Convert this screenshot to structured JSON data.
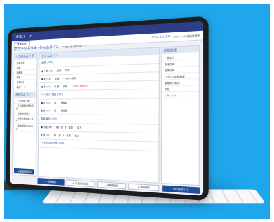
{
  "app": {
    "title": "守護パーク"
  },
  "header": {
    "tab_label": "業務画面",
    "logo_text": "ワイエスケアAI",
    "user_text": "ログイン中 施設管理者"
  },
  "left_panel": {
    "title": "クラスのようす",
    "items": [
      "基本情報",
      "記録",
      "連絡帳",
      "健康",
      "食事状況",
      "検査データ"
    ],
    "section_title": "現在のようす",
    "section_items": [
      "・生活記録 2件",
      "・生活場面の現在記録",
      "・連絡帳の記入",
      "・記録の追加をします",
      "・配信機能のお知らせ"
    ],
    "button_label": "+ 新規記録追加"
  },
  "main_panel": {
    "header_label": "タイムライン",
    "filter_label": "▼ 絞込 (全一覧表示)",
    "rows": [
      {
        "label": "記録 (1件)",
        "col1": "",
        "col2": "",
        "col3": ""
      },
      {
        "label": "● 午前 (18)",
        "col1": "記録",
        "col2": "対応",
        "col3": ""
      },
      {
        "label": "● 朝 (21)",
        "col1": "食事",
        "col2": "バイタル記録",
        "col3": ""
      },
      {
        "label": "● 昼 (21)",
        "col1": "体温",
        "col2": "血圧",
        "col3": "110/60 異常あり"
      },
      {
        "label": "バイタル 測定 (3件)",
        "col1": "",
        "col2": "",
        "col3": ""
      },
      {
        "label": "● 昼 (21)",
        "col1": "熱",
        "col2": "未確認",
        "col3": ""
      },
      {
        "label": "● 夜 (21)",
        "col1": "熱",
        "col2": "未確認",
        "col3": ""
      },
      {
        "label": "服薬管理 (3件)",
        "col1": "",
        "col2": "",
        "col3": ""
      },
      {
        "label": "● 午後 (18)",
        "col1": "朝 · 昼 · 夕 · 就寝",
        "col2": "処方",
        "col3": ""
      },
      {
        "label": "● 夜 (21)",
        "col1": "朝 · 昼 · 夕 · 就寝",
        "col2": "処方",
        "col3": ""
      },
      {
        "label": "バイタルの記録 (2件)",
        "col1": "",
        "col2": "",
        "col3": ""
      }
    ],
    "bottom_buttons": [
      "+ 記録追加",
      "+ 生活記録追加",
      "+ 連絡帳追加",
      "+ 予定追加"
    ]
  },
  "right_panel": {
    "title": "記録追加",
    "items": [
      "一覧表示",
      "生活記録",
      "健康記録",
      "バイタル記録追加",
      "連絡帳を追加",
      "予定",
      "リマインド"
    ],
    "button_label": "全て確認する"
  }
}
